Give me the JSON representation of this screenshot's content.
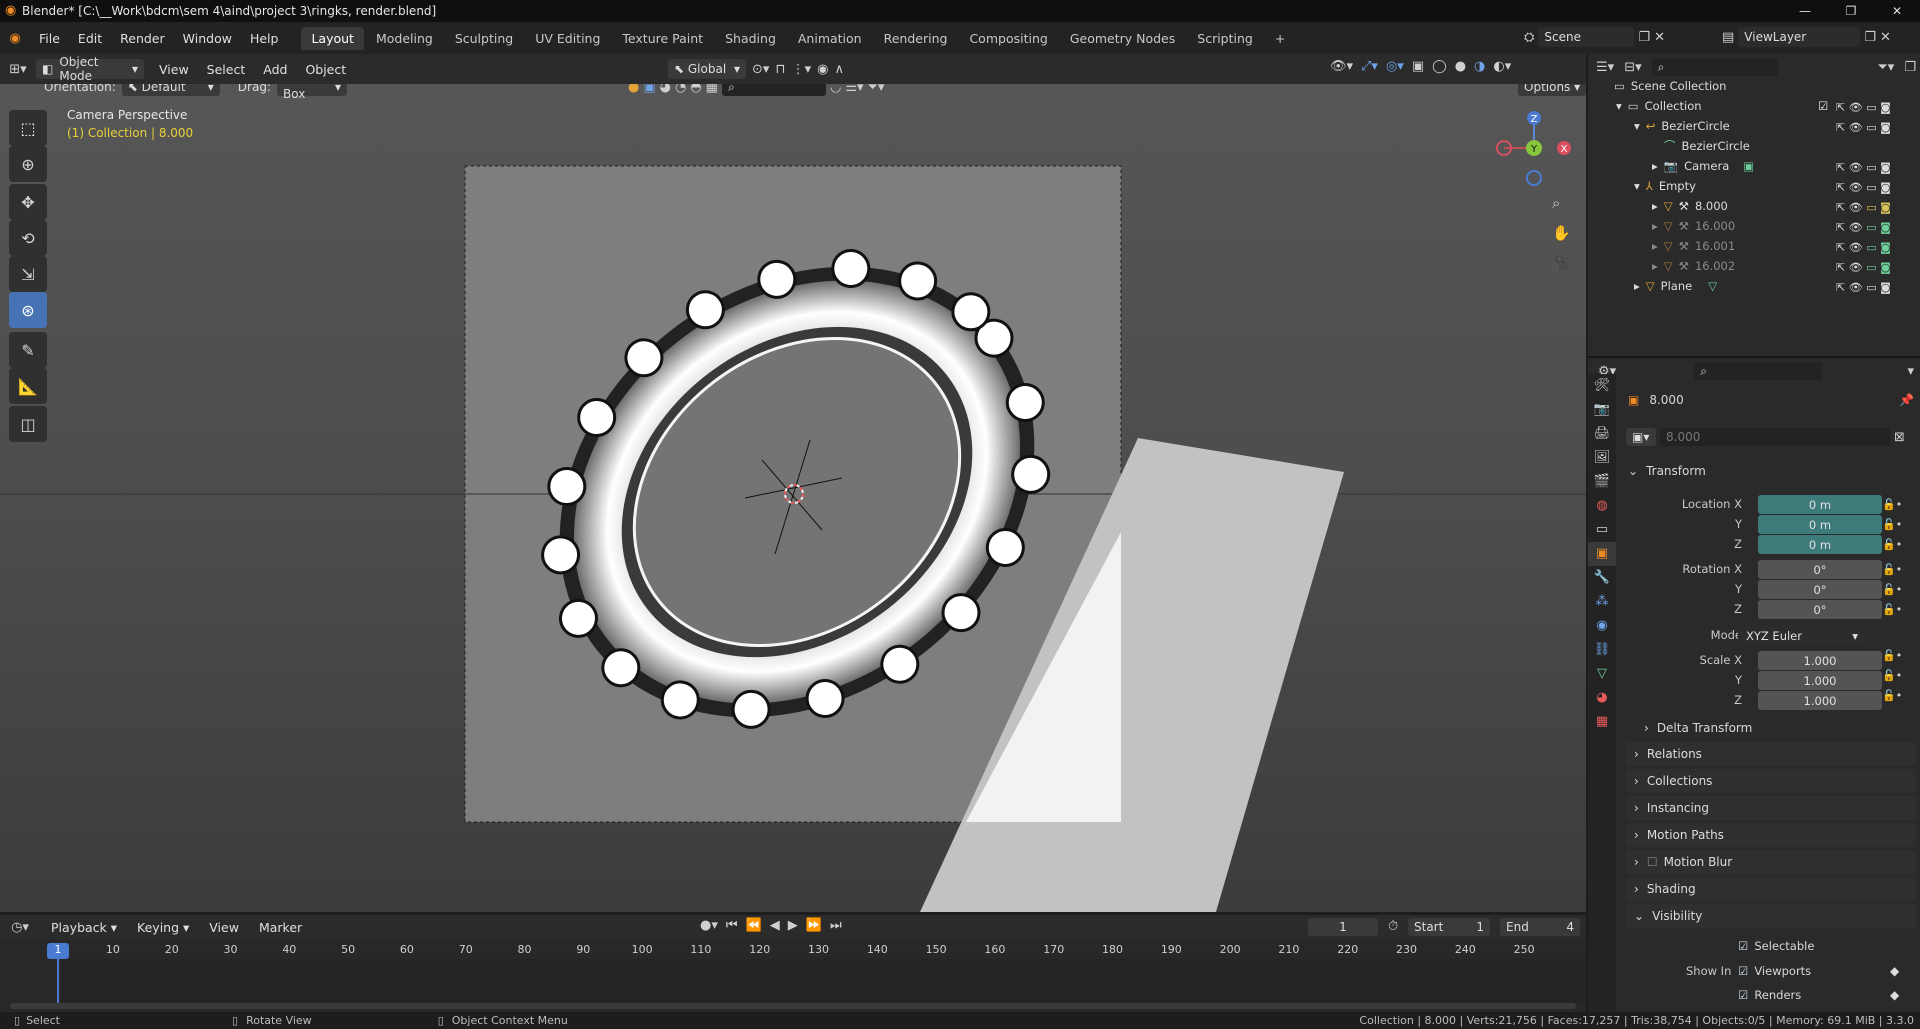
{
  "title": "Blender* [C:\\__Work\\bdcm\\sem 4\\aind\\project 3\\ringks, render.blend]",
  "menu": [
    "File",
    "Edit",
    "Render",
    "Window",
    "Help"
  ],
  "workspaces": [
    "Layout",
    "Modeling",
    "Sculpting",
    "UV Editing",
    "Texture Paint",
    "Shading",
    "Animation",
    "Rendering",
    "Compositing",
    "Geometry Nodes",
    "Scripting"
  ],
  "scene": "Scene",
  "view_layer": "ViewLayer",
  "vp": {
    "mode": "Object Mode",
    "menus": [
      "View",
      "Select",
      "Add",
      "Object"
    ],
    "transform": "Global",
    "orientation_label": "Orientation:",
    "orientation": "Default",
    "drag_label": "Drag:",
    "drag": "Select Box",
    "options": "Options",
    "perspective": "Camera Perspective",
    "collection_info": "(1) Collection | 8.000"
  },
  "gizmo": {
    "z": "Z",
    "y": "Y",
    "x": "X"
  },
  "outliner": {
    "rows": [
      {
        "label": "Scene Collection",
        "indent": 0
      },
      {
        "label": "Collection",
        "indent": 1
      },
      {
        "label": "BezierCircle",
        "indent": 2
      },
      {
        "label": "BezierCircle",
        "indent": 3
      },
      {
        "label": "Camera",
        "indent": 2
      },
      {
        "label": "Empty",
        "indent": 2
      },
      {
        "label": "8.000",
        "indent": 3
      },
      {
        "label": "16.000",
        "indent": 3
      },
      {
        "label": "16.001",
        "indent": 3
      },
      {
        "label": "16.002",
        "indent": 3
      },
      {
        "label": "Plane",
        "indent": 2
      }
    ]
  },
  "props": {
    "object_name": "8.000",
    "datablock": "8.000",
    "transform": "Transform",
    "loc_label": "Location X",
    "loc_x": "0 m",
    "loc_y": "0 m",
    "loc_z": "0 m",
    "rot_label": "Rotation X",
    "rot_x": "0°",
    "rot_y": "0°",
    "rot_z": "0°",
    "mode_label": "Mode",
    "mode": "XYZ Euler",
    "scale_label": "Scale X",
    "scale_x": "1.000",
    "scale_y": "1.000",
    "scale_z": "1.000",
    "y": "Y",
    "z": "Z",
    "delta": "Delta Transform",
    "sections": [
      "Relations",
      "Collections",
      "Instancing",
      "Motion Paths",
      "Motion Blur",
      "Shading",
      "Visibility"
    ],
    "selectable": "Selectable",
    "show_in": "Show In",
    "viewports": "Viewports",
    "renders": "Renders"
  },
  "timeline": {
    "menus": [
      "Playback",
      "Keying",
      "View",
      "Marker"
    ],
    "current": "1",
    "start_label": "Start",
    "start": "1",
    "end_label": "End",
    "end": "4",
    "ticks": [
      "1",
      "10",
      "20",
      "30",
      "40",
      "50",
      "60",
      "70",
      "80",
      "90",
      "100",
      "110",
      "120",
      "130",
      "140",
      "150",
      "160",
      "170",
      "180",
      "190",
      "200",
      "210",
      "220",
      "230",
      "240",
      "250"
    ]
  },
  "status": {
    "select": "Select",
    "rotate": "Rotate View",
    "context": "Object Context Menu",
    "stats": "Collection | 8.000 | Verts:21,756 | Faces:17,257 | Tris:38,754 | Objects:0/5 | Memory: 69.1 MiB | 3.3.0"
  }
}
